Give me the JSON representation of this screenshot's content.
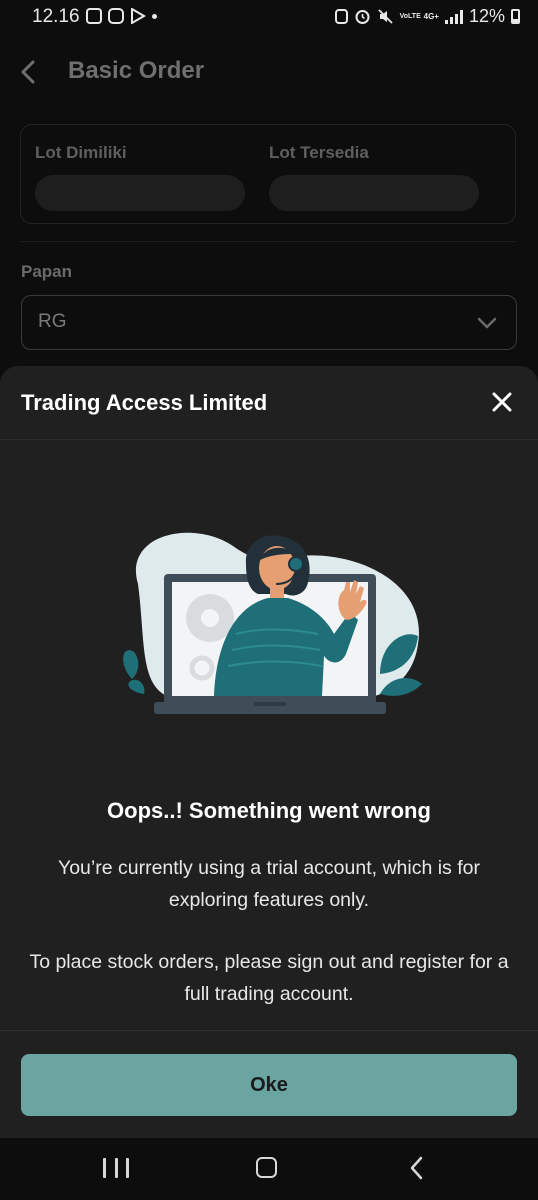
{
  "status_bar": {
    "time": "12.16",
    "network_label": "VoLTE",
    "network_type": "4G+",
    "battery": "12%"
  },
  "header": {
    "title": "Basic Order",
    "back_icon": "chevron-left-icon"
  },
  "form": {
    "lot_owned_label": "Lot Dimiliki",
    "lot_available_label": "Lot Tersedia",
    "board_label": "Papan",
    "board_value": "RG"
  },
  "sheet": {
    "title": "Trading Access Limited",
    "close_icon": "close-icon",
    "illustration": "support-agent-laptop-illustration",
    "error_title": "Oops..! Something went wrong",
    "message_1": "You’re currently using a trial account, which is for exploring features only.",
    "message_2": "To place stock orders, please sign out and register for a full trading account.",
    "ok_label": "Oke"
  },
  "colors": {
    "accent": "#6aa5a1",
    "sheet_bg": "#202020",
    "page_bg": "#0d0d0d",
    "illustration_teal": "#1f6f78"
  }
}
